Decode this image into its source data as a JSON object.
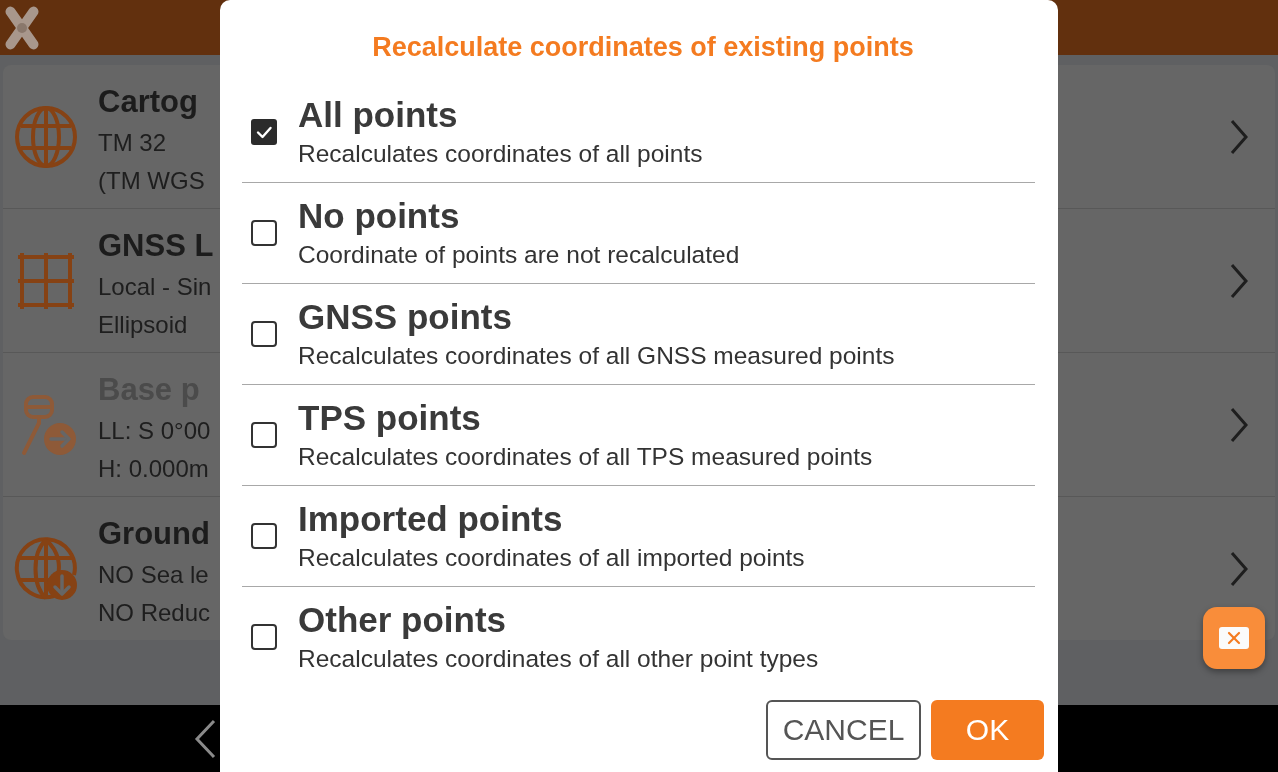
{
  "settings_list": [
    {
      "title": "Cartog",
      "lines": [
        "TM 32",
        "(TM WGS"
      ],
      "disabled": false
    },
    {
      "title": "GNSS L",
      "lines": [
        "Local - Sin",
        "Ellipsoid"
      ],
      "disabled": false
    },
    {
      "title": "Base p",
      "lines": [
        "LL: S 0°00",
        "H: 0.000m"
      ],
      "disabled": true
    },
    {
      "title": "Ground",
      "lines": [
        "NO Sea le",
        "NO Reduc"
      ],
      "disabled": false
    }
  ],
  "dialog": {
    "title": "Recalculate coordinates of existing points",
    "options": [
      {
        "label": "All points",
        "description": "Recalculates coordinates of all points",
        "checked": true
      },
      {
        "label": "No points",
        "description": "Coordinate of points are not recalculated",
        "checked": false
      },
      {
        "label": "GNSS points",
        "description": "Recalculates coordinates of all GNSS measured points",
        "checked": false
      },
      {
        "label": "TPS points",
        "description": "Recalculates coordinates of all TPS measured points",
        "checked": false
      },
      {
        "label": "Imported points",
        "description": "Recalculates coordinates of all imported points",
        "checked": false
      },
      {
        "label": "Other points",
        "description": "Recalculates coordinates of all other point types",
        "checked": false
      }
    ],
    "buttons": [
      {
        "label": "CANCEL",
        "kind": "outlined"
      },
      {
        "label": "OK",
        "kind": "filled"
      }
    ]
  }
}
